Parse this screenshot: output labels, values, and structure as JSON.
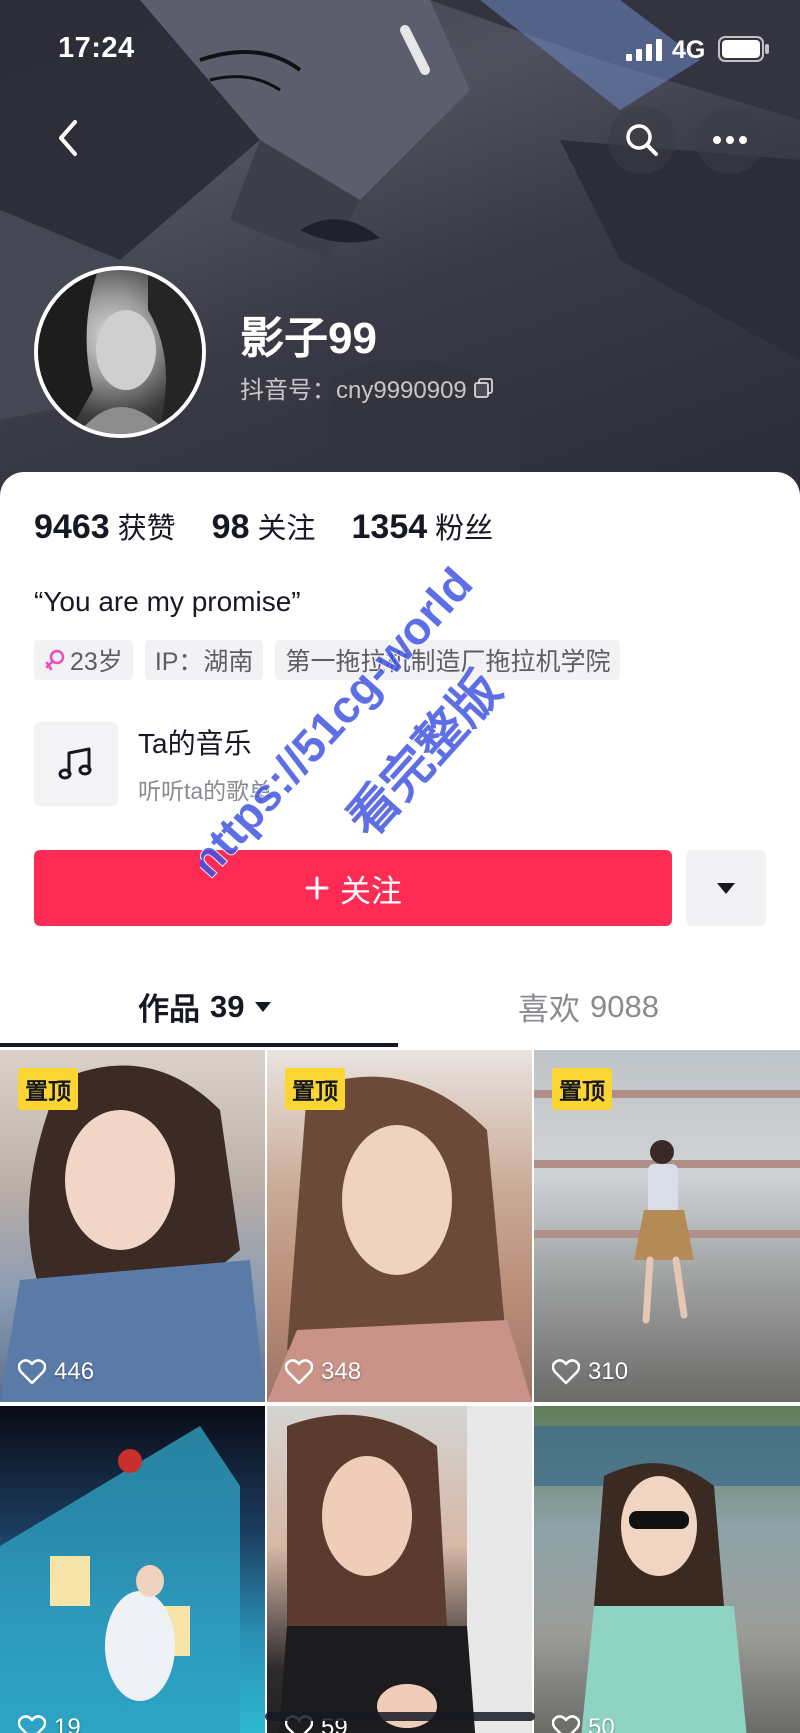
{
  "status_bar": {
    "time": "17:24",
    "network": "4G"
  },
  "profile": {
    "display_name": "影子99",
    "account_id": "抖音号：cny9990909",
    "stats": [
      {
        "value": "9463",
        "label": "获赞"
      },
      {
        "value": "98",
        "label": "关注"
      },
      {
        "value": "1354",
        "label": "粉丝"
      }
    ],
    "bio": "“You are my promise”",
    "tags": {
      "age": "23岁",
      "ip": "IP：湖南",
      "school": "第一拖拉机制造厂拖拉机学院"
    },
    "music": {
      "title": "Ta的音乐",
      "subtitle": "听听ta的歌单"
    }
  },
  "actions": {
    "follow_label": "关注"
  },
  "tabs": {
    "works": {
      "label": "作品",
      "count": "39"
    },
    "likes": {
      "label": "喜欢",
      "count": "9088"
    }
  },
  "videos": [
    {
      "pinned_label": "置顶",
      "likes": "446"
    },
    {
      "pinned_label": "置顶",
      "likes": "348"
    },
    {
      "pinned_label": "置顶",
      "likes": "310"
    },
    {
      "likes": "19"
    },
    {
      "likes": "59"
    },
    {
      "likes": "50"
    }
  ],
  "watermark": {
    "line1": "https://51cg-world",
    "line2": "看完整版"
  },
  "colors": {
    "accent": "#fe2c55",
    "pin_badge": "#fbd531",
    "watermark": "#3b4fe0"
  },
  "icons": [
    "back-arrow-icon",
    "search-icon",
    "more-icon",
    "copy-icon",
    "female-icon",
    "music-note-icon",
    "plus-icon",
    "caret-down-icon",
    "heart-icon",
    "signal-icon",
    "battery-icon"
  ]
}
